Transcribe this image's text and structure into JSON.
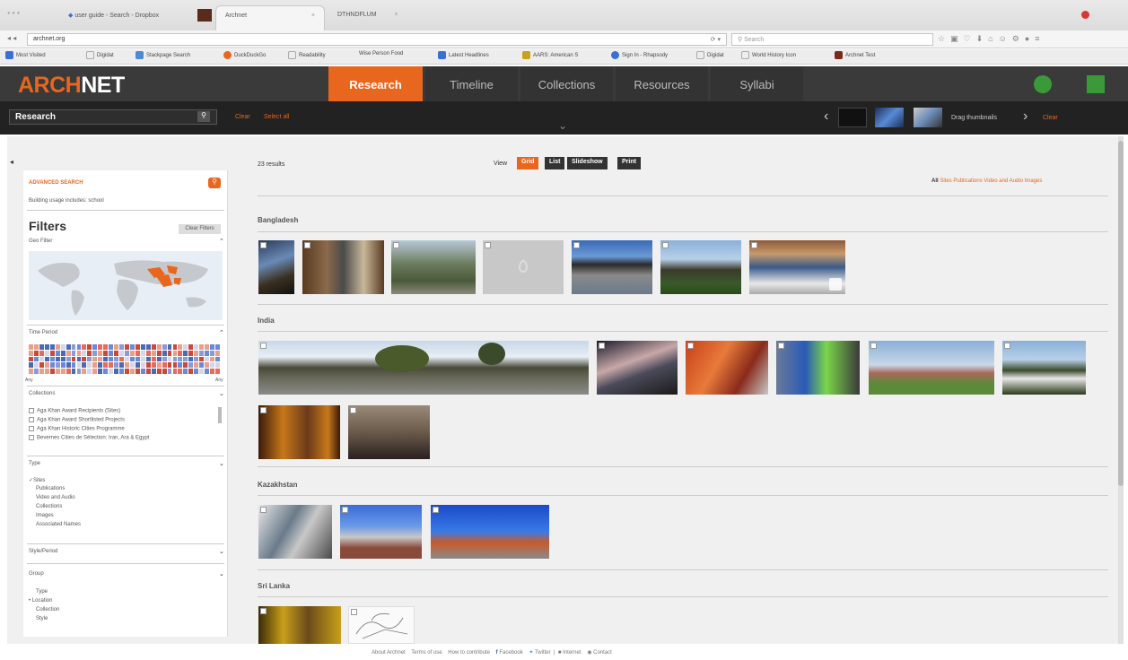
{
  "browser": {
    "tabs": [
      "user guide - Search - Dropbox",
      "Archnet",
      "DTHNDFLUM"
    ],
    "url": "archnet.org",
    "search_placeholder": "Search",
    "bookmarks": [
      "Most Visited",
      "Digidat",
      "Stackpage Search",
      "DuckDuckGo",
      "Readability",
      "Wise Person Food",
      "Latest Headlines",
      "AARS: American S",
      "Sign In - Rhapsody",
      "Digidat",
      "World History Icon",
      "Archnet Test"
    ]
  },
  "site": {
    "logo_part1": "ARCH",
    "logo_part2": "NET",
    "nav": [
      "Research",
      "Timeline",
      "Collections",
      "Resources",
      "Syllabi"
    ],
    "search_label": "Research",
    "clear": "Clear",
    "select_all": "Select all",
    "drag_thumbnails": "Drag thumbnails",
    "clear_right": "Clear"
  },
  "sidebar": {
    "advanced_search": "ADVANCED SEARCH",
    "search_desc": "Building usage includes: school",
    "filters": "Filters",
    "clear_filters": "Clear Filters",
    "geo_filter": "Geo Filter",
    "time_period": "Time Period",
    "time_from": "Any",
    "time_to": "Any",
    "collections_label": "Collections",
    "collections": [
      "Aga Khan Award Recipients (Sites)",
      "Aga Khan Award Shortlisted Projects",
      "Aga Khan Historic Cities Programme",
      "Bevernes Cities de Sélection: Iran, Ara & Egypt"
    ],
    "type_label": "Type",
    "types": [
      "Sites",
      "Publications",
      "Video and Audio",
      "Collections",
      "Images",
      "Associated Names"
    ],
    "style_label": "Style/Period",
    "group_label": "Group",
    "groups": [
      "Type",
      "Location",
      "Collection",
      "Style"
    ]
  },
  "results": {
    "count": "23 results",
    "view_label": "View",
    "views": [
      "Grid",
      "List",
      "Slideshow",
      "Print"
    ],
    "filter_all": "All",
    "filter_links": [
      "Sites",
      "Publications",
      "Video and Audio",
      "Images"
    ],
    "groups": [
      "Bangladesh",
      "India",
      "Kazakhstan",
      "Sri Lanka"
    ]
  },
  "footer": {
    "links": [
      "About Archnet",
      "Terms of use",
      "How to contribute",
      "Facebook",
      "Twitter",
      "Internet",
      "Contact"
    ]
  },
  "colors": {
    "accent": "#e8661d",
    "header": "#3a3a3a",
    "subheader": "#222222"
  }
}
